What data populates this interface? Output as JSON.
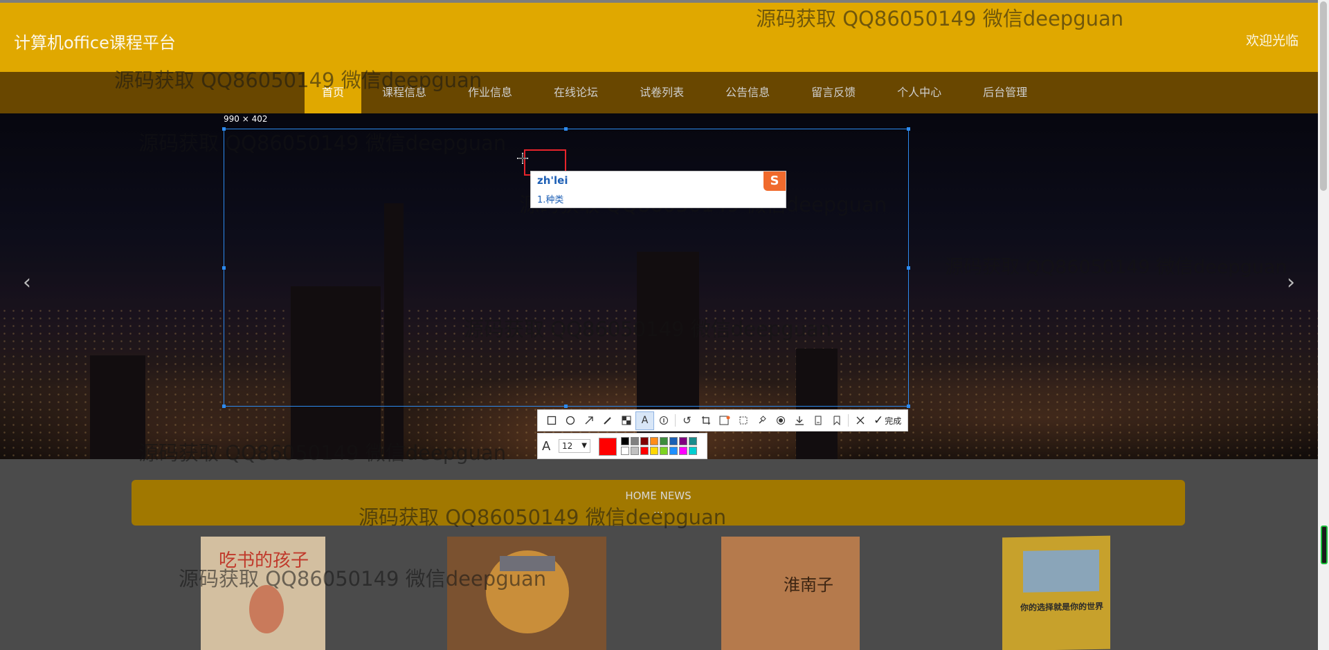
{
  "header": {
    "site_title": "计算机office课程平台",
    "welcome": "欢迎光临"
  },
  "nav": {
    "items": [
      {
        "label": "首页",
        "active": true
      },
      {
        "label": "课程信息"
      },
      {
        "label": "作业信息"
      },
      {
        "label": "在线论坛"
      },
      {
        "label": "试卷列表"
      },
      {
        "label": "公告信息"
      },
      {
        "label": "留言反馈"
      },
      {
        "label": "个人中心"
      },
      {
        "label": "后台管理"
      }
    ]
  },
  "banner": {
    "prev_icon": "chevron-left-icon",
    "next_icon": "chevron-right-icon"
  },
  "news": {
    "title_en": "HOME NEWS",
    "title_cn": "…"
  },
  "books": [
    {
      "title": "吃书的孩子"
    },
    {
      "title": ""
    },
    {
      "title": "淮南子"
    },
    {
      "title": "你的选择就是你的世界"
    }
  ],
  "watermark": {
    "text": "源码获取 QQ86050149 微信deepguan"
  },
  "capture_tool": {
    "size_label": "990 × 402",
    "ime": {
      "input": "zh'lei",
      "candidates": "1.种类"
    },
    "toolbar": {
      "tools": [
        "rectangle-icon",
        "ellipse-icon",
        "arrow-icon",
        "pencil-icon",
        "mosaic-icon",
        "text-icon",
        "number-icon",
        "undo-icon",
        "crop-icon",
        "ocr-icon",
        "scroll-capture-icon",
        "pin-icon",
        "record-icon",
        "download-icon",
        "save-icon",
        "bookmark-icon",
        "close-icon"
      ],
      "active_tool": "text-icon",
      "done_label": "完成"
    },
    "text_options": {
      "font_size": "12",
      "current_color": "#ff0000",
      "palette": [
        "#000000",
        "#808080",
        "#800000",
        "#ff8c1a",
        "#3c8c3c",
        "#1a5fb4",
        "#800080",
        "#1a8c8c",
        "#ffffff",
        "#c0c0c0",
        "#ff0000",
        "#ffd700",
        "#7dd321",
        "#1e90ff",
        "#ff00ff",
        "#00ced1"
      ]
    }
  }
}
